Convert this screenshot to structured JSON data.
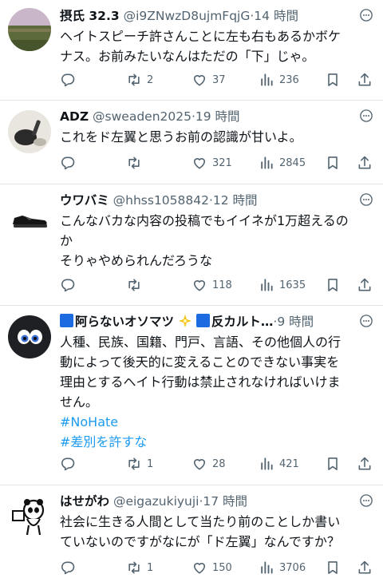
{
  "posts": [
    {
      "name": "摂氏 32.3",
      "handle": "@i9ZNwzD8ujmFqjG",
      "time": "·14 時間",
      "lines": [
        "ヘイトスピーチ許さんことに左も右もあるかボケ",
        "ナス。お前みたいなんはただの「下」じゃ。"
      ],
      "replies": "",
      "reposts": "2",
      "likes": "37",
      "views": "236"
    },
    {
      "name": "ADZ",
      "handle": "@sweaden2025",
      "time": "·19 時間",
      "lines": [
        "これをド左翼と思うお前の認識が甘いよ。"
      ],
      "replies": "",
      "reposts": "",
      "likes": "321",
      "views": "2845"
    },
    {
      "name": "ウワバミ",
      "handle": "@hhss1058842",
      "time": "·12 時間",
      "lines": [
        "こんなバカな内容の投稿でもイイネが1万超えるの",
        "か",
        "そりゃやめられんだろうな"
      ],
      "replies": "",
      "reposts": "",
      "likes": "118",
      "views": "1635"
    },
    {
      "name_a": "阿らないオソマツ",
      "name_b": "反カルト…",
      "time": "·9 時間",
      "lines": [
        "人種、民族、国籍、門戸、言語、その他個人の行",
        "動によって後天的に変えることのできない事実を",
        "理由とするヘイト行動は禁止されなければいけま",
        "せん。"
      ],
      "hashtags": [
        "#NoHate",
        "#差別を許すな"
      ],
      "replies": "",
      "reposts": "1",
      "likes": "28",
      "views": "421"
    },
    {
      "name": "はせがわ",
      "handle": "@eigazukiyuji",
      "time": "·17 時間",
      "lines": [
        "社会に生きる人間として当たり前のことしか書い",
        "ていないのですがなにが「ド左翼」なんですか？"
      ],
      "replies": "",
      "reposts": "1",
      "likes": "150",
      "views": "3706"
    }
  ],
  "colors": {
    "accent": "#1d9bf0",
    "muted": "#536471",
    "flag": "#1d6be0"
  },
  "icons": [
    "more-icon",
    "reply-icon",
    "repost-icon",
    "like-icon",
    "views-icon",
    "bookmark-icon",
    "share-icon",
    "flag-emoji-icon",
    "sparkle-emoji-icon"
  ]
}
